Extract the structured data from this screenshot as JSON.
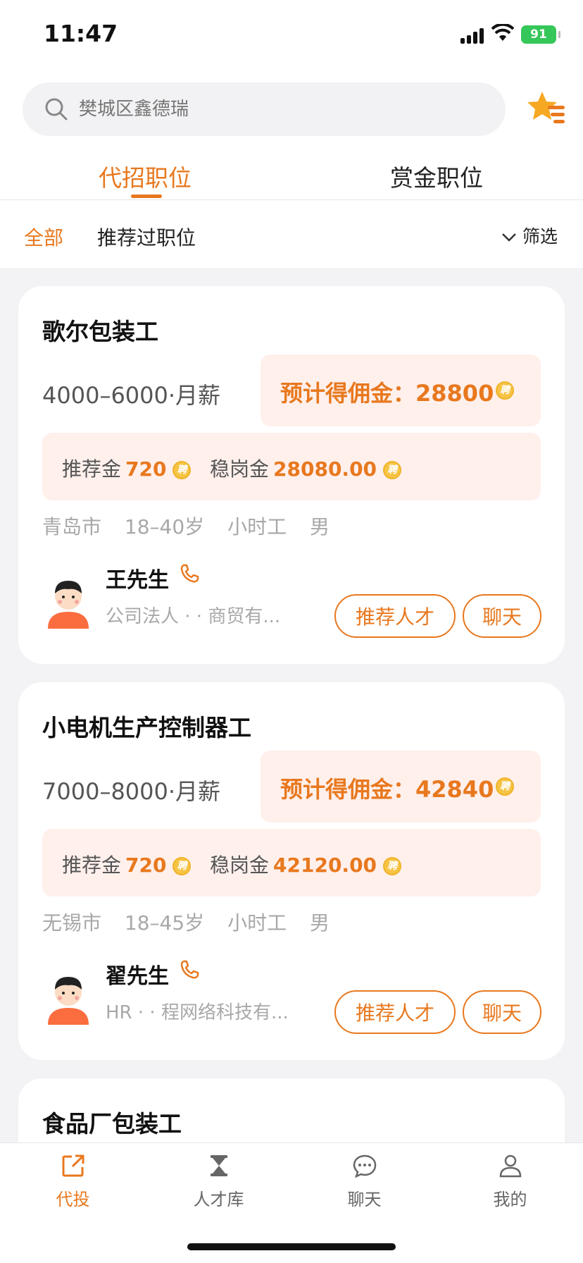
{
  "status_bar": {
    "time": "11:47",
    "battery": "91"
  },
  "search": {
    "placeholder": "樊城区鑫德瑞"
  },
  "tabs": [
    {
      "label": "代招职位",
      "active": true
    },
    {
      "label": "赏金职位",
      "active": false
    }
  ],
  "filters": {
    "all": "全部",
    "recommended": "推荐过职位",
    "screen": "筛选"
  },
  "jobs": [
    {
      "title": "歌尔包装工",
      "salary": "4000–6000·月薪",
      "commission": "预计得佣金：28800",
      "referral": {
        "label": "推荐金",
        "value": "720"
      },
      "retention": {
        "label": "稳岗金",
        "value": "28080.00"
      },
      "tags": [
        "青岛市",
        "18–40岁",
        "小时工",
        "男"
      ],
      "contact": "王先生",
      "company": "公司法人 ·  ·  商贸有...",
      "recommend_btn": "推荐人才",
      "chat_btn": "聊天"
    },
    {
      "title": "小电机生产控制器工",
      "salary": "7000–8000·月薪",
      "commission": "预计得佣金：42840",
      "referral": {
        "label": "推荐金",
        "value": "720"
      },
      "retention": {
        "label": "稳岗金",
        "value": "42120.00"
      },
      "tags": [
        "无锡市",
        "18–45岁",
        "小时工",
        "男"
      ],
      "contact": "翟先生",
      "company": "HR ·  · 程网络科技有...",
      "recommend_btn": "推荐人才",
      "chat_btn": "聊天"
    },
    {
      "title": "食品厂包装工"
    }
  ],
  "bottom_nav": [
    {
      "label": "代投",
      "icon": "share-icon",
      "active": true
    },
    {
      "label": "人才库",
      "icon": "hourglass-icon",
      "active": false
    },
    {
      "label": "聊天",
      "icon": "chat-bubble-icon",
      "active": false
    },
    {
      "label": "我的",
      "icon": "person-icon",
      "active": false
    }
  ],
  "colors": {
    "accent": "#e8781e",
    "accent_bg": "#fff0ec",
    "coin": "#f6c445"
  }
}
